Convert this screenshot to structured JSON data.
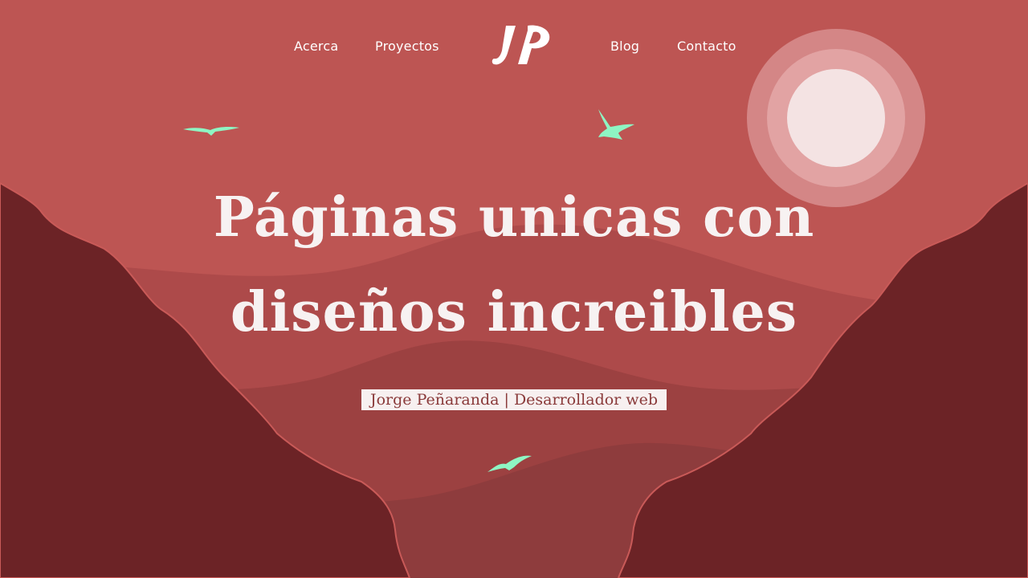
{
  "nav": {
    "items": [
      {
        "label": "Acerca"
      },
      {
        "label": "Proyectos"
      },
      {
        "label": "Blog"
      },
      {
        "label": "Contacto"
      }
    ],
    "logo_text": "JP"
  },
  "hero": {
    "title_line1": "Páginas unicas con",
    "title_line2": "diseños increibles",
    "subtitle": "Jorge Peñaranda | Desarrollador web"
  },
  "colors": {
    "sky": "#bd5553",
    "hill_far": "#ad4a4a",
    "hill_mid": "#9c4141",
    "hill_near": "#8e3c3d",
    "cliffs": "#6c2326",
    "sun_core": "#f4e3e3",
    "sun_ring1": "#e2a3a3",
    "sun_ring2": "#d48686",
    "birds": "#8ef5c3",
    "title": "#f7f2f2"
  },
  "icons": [
    "logo-jp",
    "sun-icon",
    "bird-icon"
  ]
}
